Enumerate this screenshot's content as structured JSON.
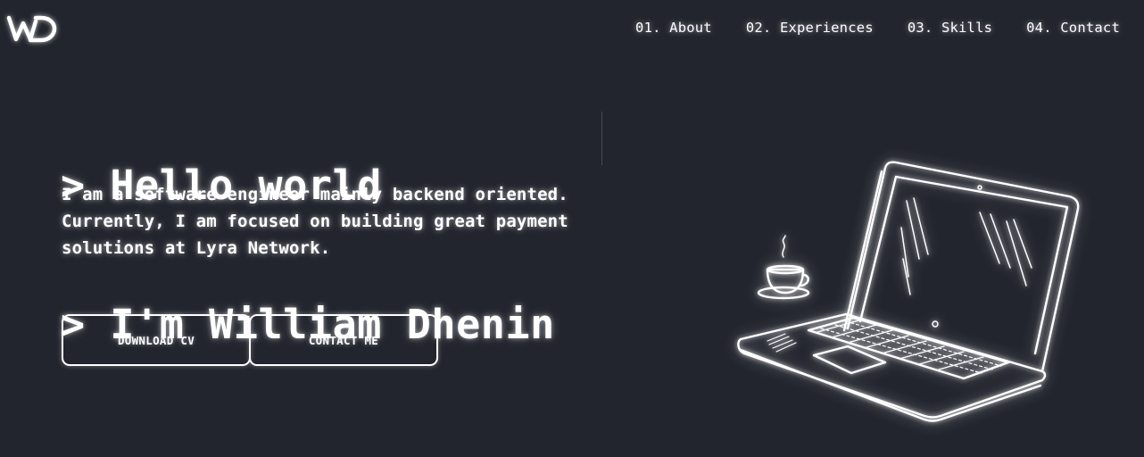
{
  "brand": {
    "logo_text": "WD"
  },
  "nav": {
    "items": [
      {
        "label": "01. About"
      },
      {
        "label": "02. Experiences"
      },
      {
        "label": "03. Skills"
      },
      {
        "label": "04. Contact"
      }
    ]
  },
  "hero": {
    "title_line_1": "> Hello world",
    "title_line_2": "> I'm William Dhenin",
    "description_lines": [
      "I am a software engineer mainly backend oriented.",
      "Currently, I am focused on building great payment",
      "solutions at Lyra Network."
    ],
    "buttons": {
      "download_cv": "DOWNLOAD CV",
      "contact_me": "CONTACT ME"
    }
  },
  "illustration": {
    "name": "laptop-with-coffee-cup-illustration"
  },
  "colors": {
    "background": "#23252e",
    "foreground": "#ffffff"
  }
}
